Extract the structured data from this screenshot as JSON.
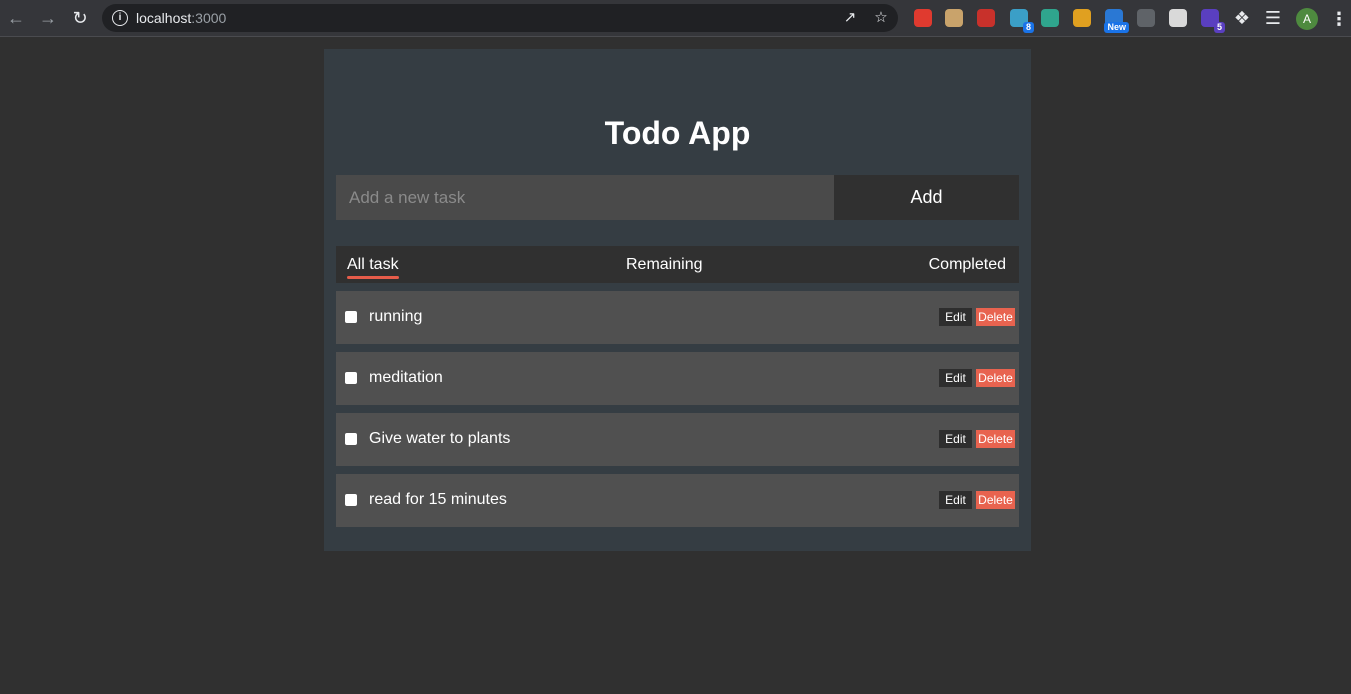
{
  "browser": {
    "url_host": "localhost",
    "url_port": ":3000",
    "extensions": [
      {
        "name": "adblock-icon",
        "color": "#e03a2f",
        "badge": ""
      },
      {
        "name": "owl-icon",
        "color": "#c9a36b",
        "badge": ""
      },
      {
        "name": "red-extension-icon",
        "color": "#c8312b",
        "badge": ""
      },
      {
        "name": "tracker-extension-icon",
        "color": "#3b9fc7",
        "badge": "8"
      },
      {
        "name": "ring-extension-icon",
        "color": "#2fa58d",
        "badge": ""
      },
      {
        "name": "color-picker-icon",
        "color": "#e0a020",
        "badge": ""
      },
      {
        "name": "new-extension-icon",
        "color": "#2a78d4",
        "badge": "New"
      },
      {
        "name": "gray-extension-icon",
        "color": "#5f6368",
        "badge": ""
      },
      {
        "name": "notes-extension-icon",
        "color": "#d9d9d9",
        "badge": ""
      },
      {
        "name": "purple-extension-icon",
        "color": "#5a3fc0",
        "badge": "5"
      }
    ],
    "avatar_letter": "A"
  },
  "app": {
    "title": "Todo App",
    "input_placeholder": "Add a new task",
    "input_value": "",
    "add_label": "Add",
    "filters": {
      "all": "All task",
      "remaining": "Remaining",
      "completed": "Completed",
      "active": "all"
    },
    "tasks": [
      {
        "text": "running",
        "checked": false
      },
      {
        "text": "meditation",
        "checked": false
      },
      {
        "text": "Give water to plants",
        "checked": false
      },
      {
        "text": "read for 15 minutes",
        "checked": false
      }
    ],
    "edit_label": "Edit",
    "delete_label": "Delete",
    "colors": {
      "page_bg": "#303030",
      "card_bg": "#353d43",
      "accent": "#e8634f"
    }
  }
}
